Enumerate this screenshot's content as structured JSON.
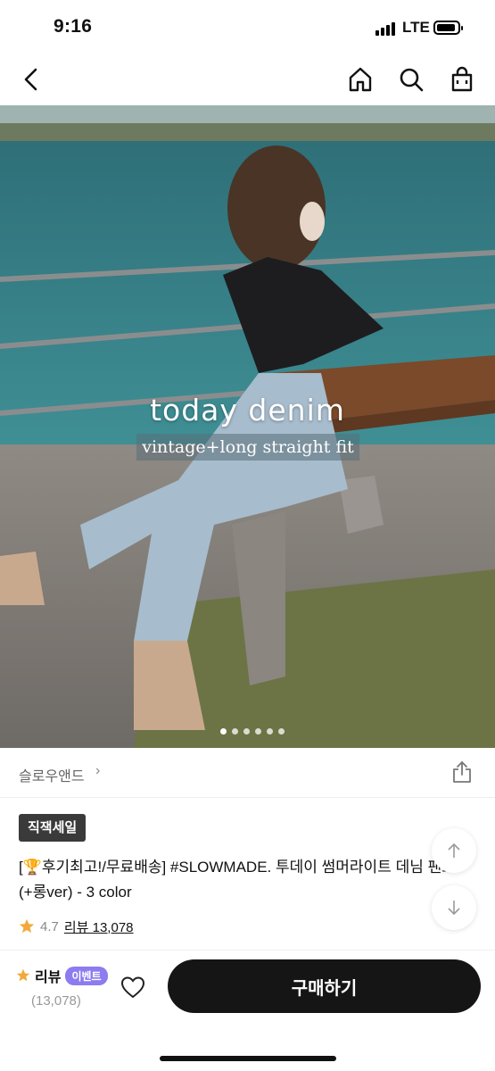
{
  "status_bar": {
    "time": "9:16",
    "network": "LTE"
  },
  "nav": {
    "icons": [
      "back-icon",
      "home-icon",
      "search-icon",
      "shopping-bag-icon"
    ]
  },
  "hero": {
    "headline": "today denim",
    "subheadline": "vintage+long straight fit",
    "slide_count": 6,
    "active_slide": 1
  },
  "brand": {
    "name": "슬로우앤드",
    "chevron": "›"
  },
  "product": {
    "badge": "직잭세일",
    "trophy": "🏆",
    "title": "후기최고!/무료배송] #SLOWMADE. 투데이 썸머라이트 데님 팬츠 (+롱ver) - 3 color",
    "title_prefix": "[",
    "rating": "4.7",
    "reviews_link": "리뷰 13,078"
  },
  "bottom_bar": {
    "review_label": "리뷰",
    "event_badge": "이벤트",
    "review_count": "(13,078)",
    "buy_label": "구매하기"
  },
  "colors": {
    "buy_button": "#151515",
    "event_badge": "#8c7cf0",
    "star": "#f2a93b",
    "sale_badge": "#3a3a3a"
  }
}
